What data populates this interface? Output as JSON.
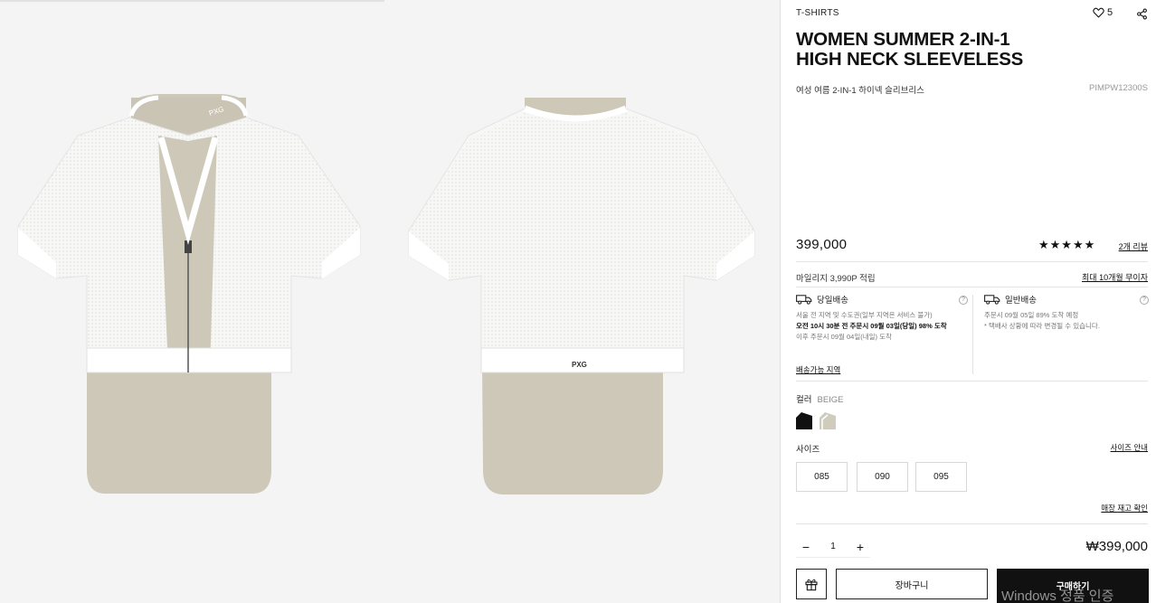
{
  "product": {
    "category": "T-SHIRTS",
    "wish_count": "5",
    "title_line1": "WOMEN SUMMER 2-IN-1",
    "title_line2": "HIGH NECK SLEEVELESS",
    "subtitle": "여성 여름 2-IN-1 하이넥 슬리브리스",
    "sku": "PIMPW12300S",
    "price": "399,000",
    "rating": "★★★★★",
    "review_link": "2개 리뷰",
    "mileage": "마일리지 3,990P 적립",
    "installment_link": "최대 10개월 무이자"
  },
  "images": {
    "front_logo": "PXG",
    "back_logo": "PXG"
  },
  "shipping": {
    "same_day": {
      "label": "당일배송",
      "line1": "서울 전 지역 및 수도권(일부 지역은 서비스 불가)",
      "line2": "오전 10시 30분 전 주문시 09월 03일(당일) 98% 도착",
      "line3": "이후 주문시 09월 04일(내일) 도착"
    },
    "standard": {
      "label": "일반배송",
      "line1": "주문시 09월 05일 89% 도착 예정",
      "line2": "* 택배사 상황에 따라 변경될 수 있습니다."
    },
    "area_link": "배송가능 지역",
    "help_glyph": "?"
  },
  "options": {
    "color_label": "컬러",
    "color_value": "BEIGE",
    "colors": [
      "#111111",
      "#cfcbbd"
    ],
    "size_label": "사이즈",
    "size_guide": "사이즈 안내",
    "sizes": [
      "085",
      "090",
      "095"
    ],
    "stock_link": "매장 재고 확인"
  },
  "order": {
    "qty_minus": "−",
    "qty_value": "1",
    "qty_plus": "+",
    "total": "₩399,000",
    "cart_label": "장바구니",
    "buy_label": "구매하기"
  },
  "watermark": "Windows 정품 인증"
}
